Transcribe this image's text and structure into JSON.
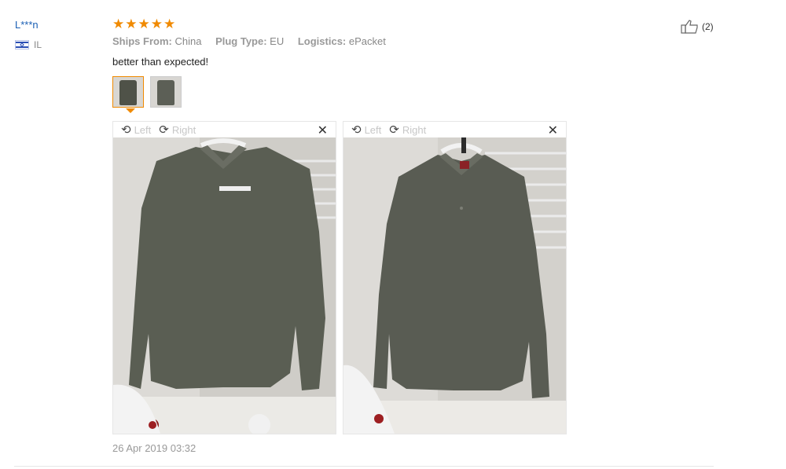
{
  "user": {
    "name": "L***n",
    "country": "IL"
  },
  "rating": {
    "stars": 5,
    "max": 5,
    "color": "#f08a00"
  },
  "attributes": [
    {
      "label": "Ships From:",
      "value": "China"
    },
    {
      "label": "Plug Type:",
      "value": "EU"
    },
    {
      "label": "Logistics:",
      "value": "ePacket"
    }
  ],
  "review": {
    "text": "better than expected!"
  },
  "helpful": {
    "count": "(2)"
  },
  "viewer": {
    "rotate_left": "Left",
    "rotate_right": "Right"
  },
  "timestamp": "26 Apr 2019 03:32"
}
